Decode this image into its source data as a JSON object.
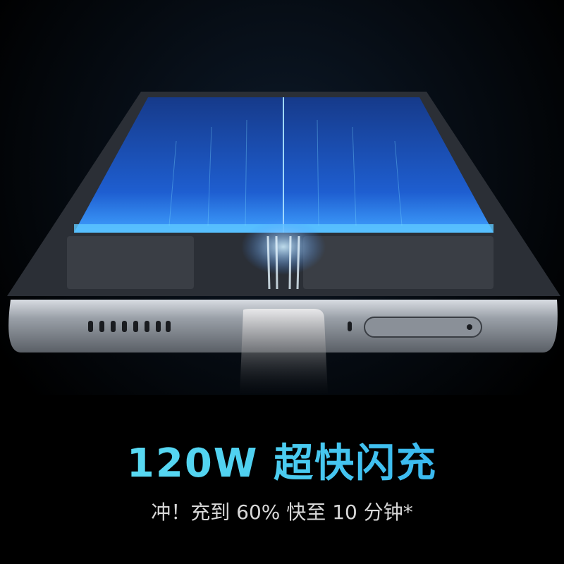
{
  "headline": "120W 超快闪充",
  "subheadline": "冲！充到 60% 快至 10 分钟*",
  "colors": {
    "accent_start": "#62e3f5",
    "accent_end": "#2aa8ef",
    "background": "#000000"
  }
}
